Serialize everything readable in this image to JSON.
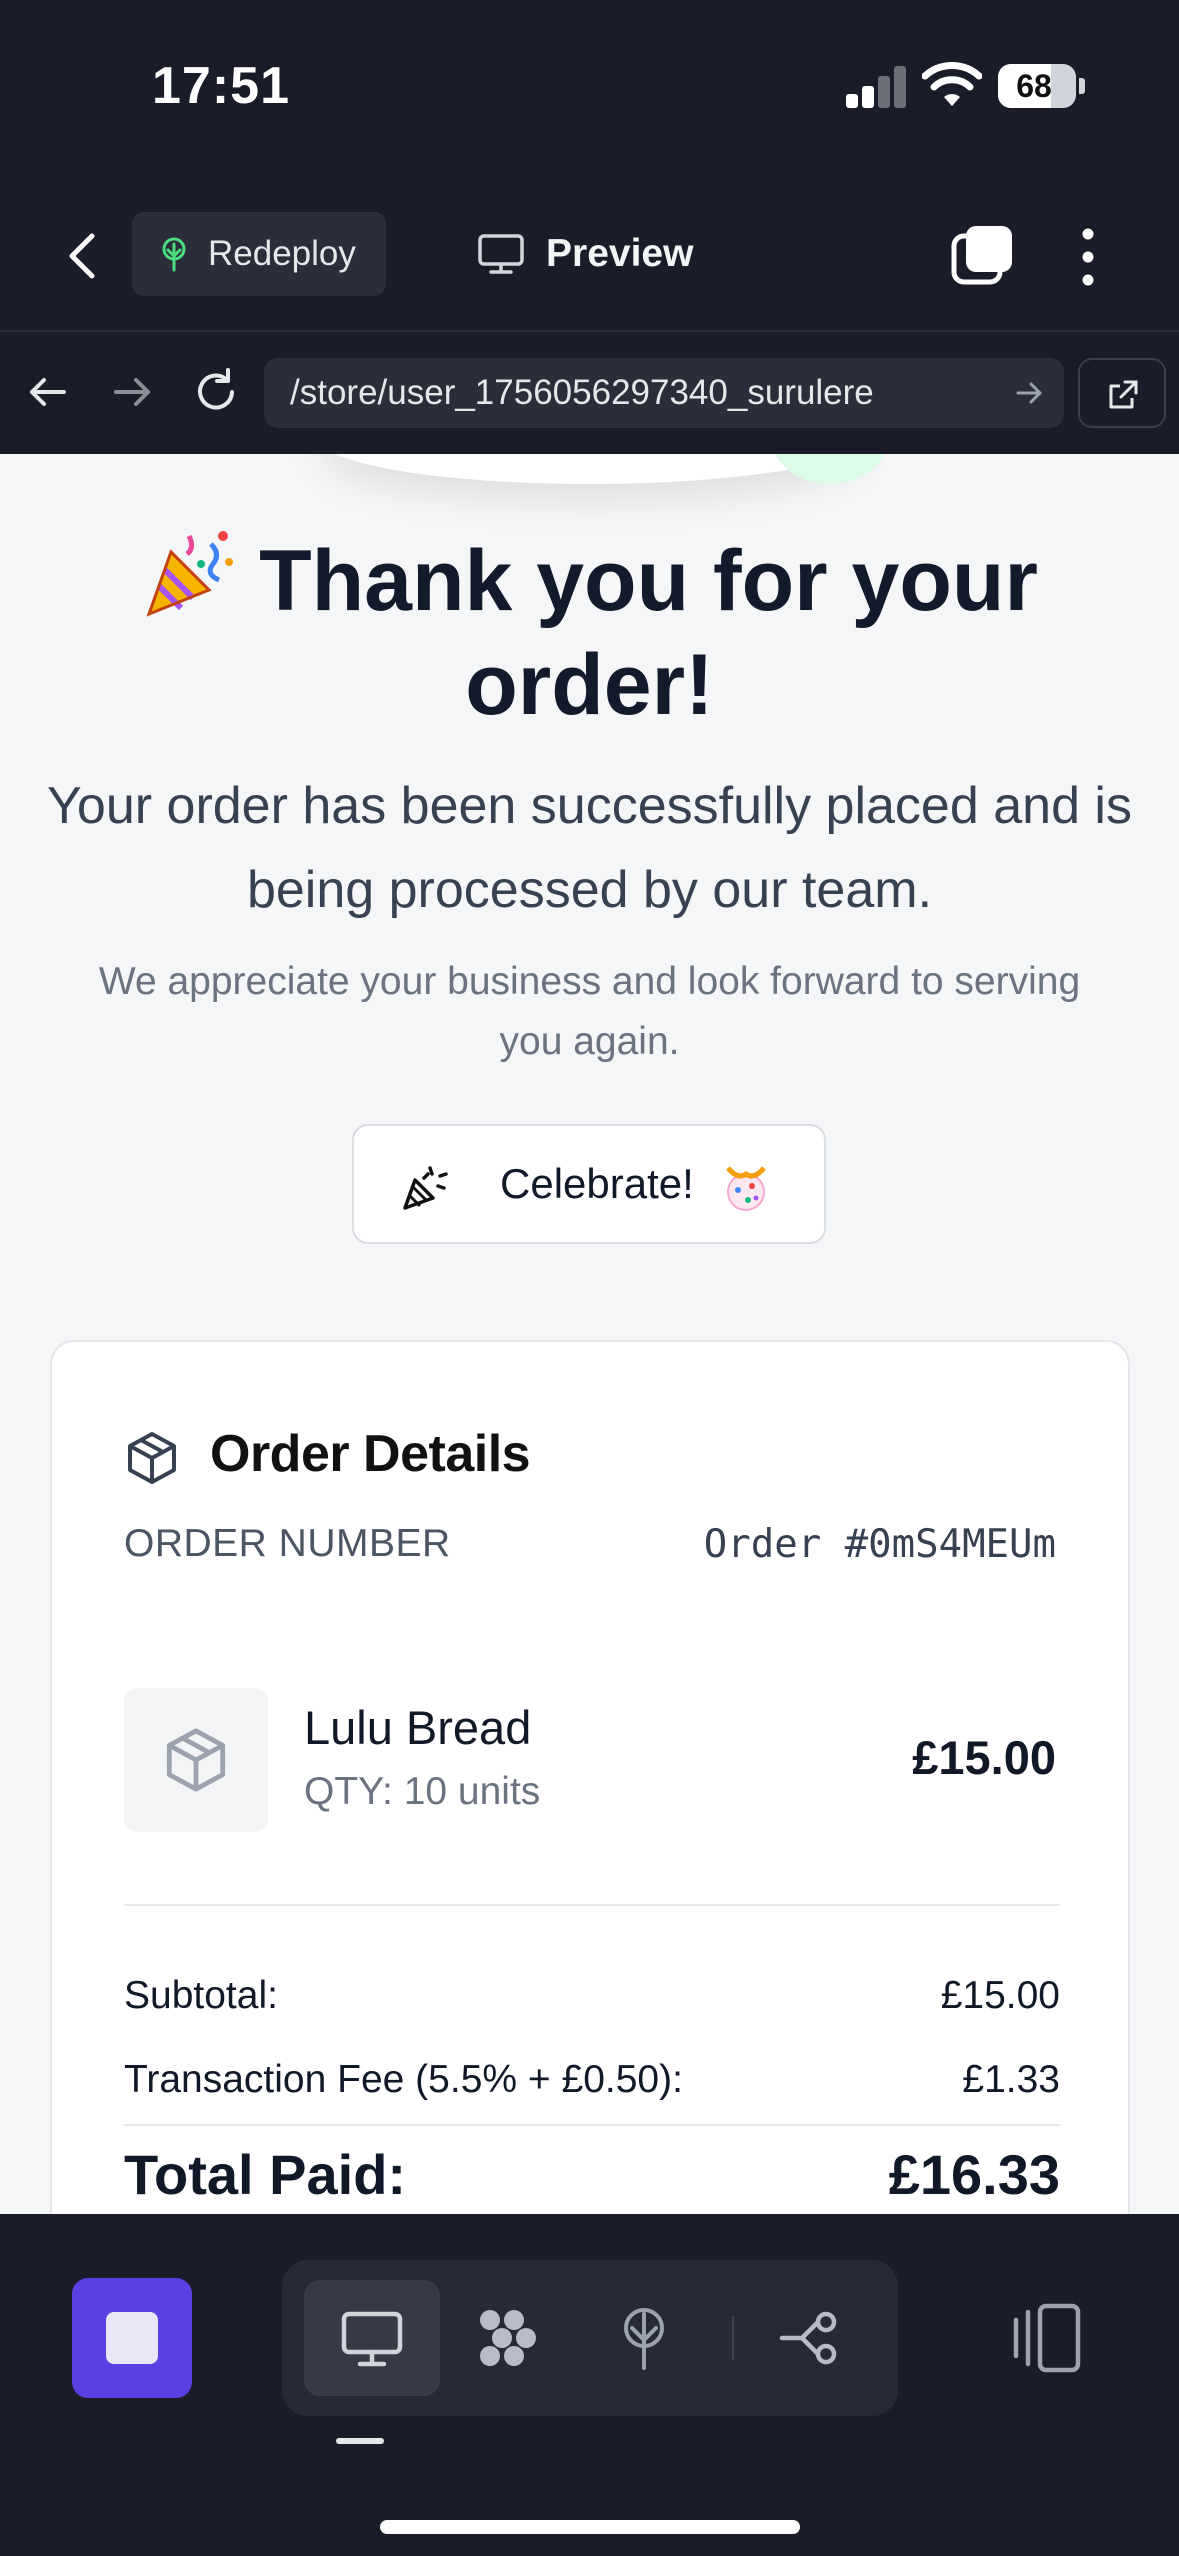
{
  "status_bar": {
    "time": "17:51",
    "battery": "68"
  },
  "toolbar": {
    "redeploy_label": "Redeploy",
    "preview_label": "Preview"
  },
  "browser": {
    "url": "/store/user_1756056297340_surulere"
  },
  "page": {
    "heading": "Thank you for your order!",
    "subtitle": "Your order has been successfully placed and is being processed by our team.",
    "note": "We appreciate your business and look forward to serving you again.",
    "celebrate_label": "Celebrate!"
  },
  "order": {
    "title": "Order Details",
    "number_label": "ORDER NUMBER",
    "number_value": "Order #0mS4MEUm",
    "item": {
      "name": "Lulu Bread",
      "qty": "QTY: 10 units",
      "price": "£15.00"
    },
    "subtotal_label": "Subtotal:",
    "subtotal_value": "£15.00",
    "fee_label": "Transaction Fee (5.5% + £0.50):",
    "fee_value": "£1.33",
    "total_label": "Total Paid:",
    "total_value": "£16.33"
  },
  "icons": {
    "redeploy": "tree-icon",
    "preview": "monitor-icon",
    "order": "package-icon",
    "celebrate": "party-popper-icon"
  },
  "colors": {
    "chrome_bg": "#1a1d29",
    "accent_purple": "#5b3fe0",
    "page_bg": "#f5f6f8",
    "redeploy_green": "#4ade80"
  }
}
